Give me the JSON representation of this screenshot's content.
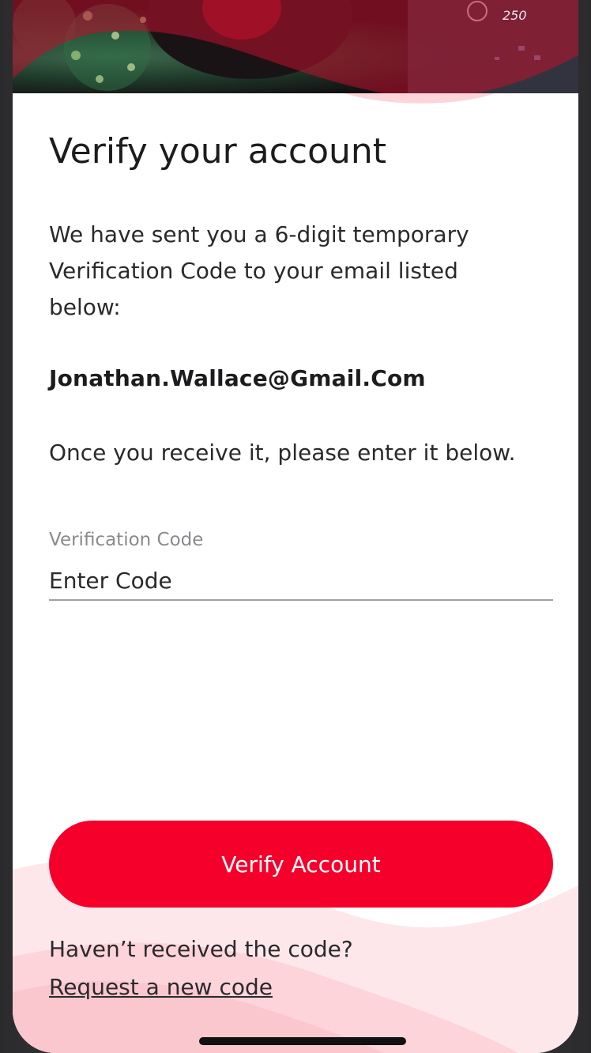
{
  "header": {
    "hero_image_desc": "car-interior-photo",
    "dashboard_readout": "250"
  },
  "main": {
    "title": "Verify your account",
    "description": "We have sent you a 6-digit temporary Verification Code to your email listed below:",
    "email": "Jonathan.Wallace@Gmail.Com",
    "instruction": "Once you receive it, please enter it below.",
    "field": {
      "label": "Verification Code",
      "placeholder": "Enter Code",
      "value": ""
    },
    "verify_button_label": "Verify Account",
    "no_code_text": "Haven’t received the code?",
    "request_link_label": "Request a new code"
  },
  "colors": {
    "accent": "#f5002b",
    "wave_pink": "#fbd5da",
    "text_dark": "#1c1c1e"
  }
}
